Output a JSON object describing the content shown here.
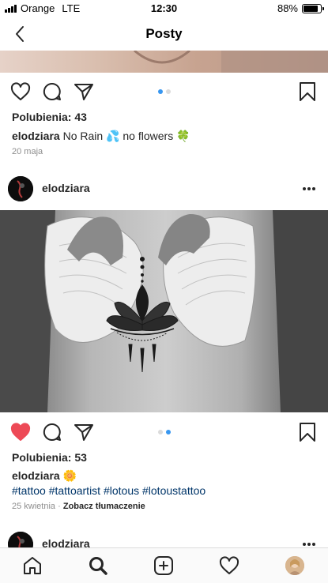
{
  "status_bar": {
    "carrier": "Orange",
    "network": "LTE",
    "time": "12:30",
    "battery": "88%",
    "battery_level": 0.88
  },
  "header": {
    "title": "Posty"
  },
  "post1": {
    "likes": "Polubienia: 43",
    "username": "elodziara",
    "caption": "No Rain 💦 no flowers 🍀",
    "date": "20 maja",
    "carousel": {
      "total": 2,
      "active": 1
    }
  },
  "post2": {
    "username": "elodziara",
    "liked": true,
    "likes": "Polubienia: 53",
    "caption": "🌼",
    "hashtags": "#tattoo #tattoartist #lotous #lotoustattoo",
    "date": "25 kwietnia",
    "separator": "·",
    "translate": "Zobacz tłumaczenie",
    "carousel": {
      "total": 2,
      "active": 2
    }
  },
  "post3": {
    "username": "elodziara"
  },
  "icons": {
    "back": "chevron-left-icon",
    "like": "heart-icon",
    "comment": "comment-icon",
    "share": "paper-plane-icon",
    "save": "bookmark-icon",
    "more": "more-dots-icon",
    "home": "home-icon",
    "search": "search-icon",
    "add": "add-post-icon",
    "activity": "heart-icon",
    "profile": "profile-avatar"
  },
  "colors": {
    "like_red": "#ed4956",
    "link_blue": "#003569",
    "dot_active": "#3897f0",
    "text": "#262626",
    "muted": "#8e8e8e"
  }
}
